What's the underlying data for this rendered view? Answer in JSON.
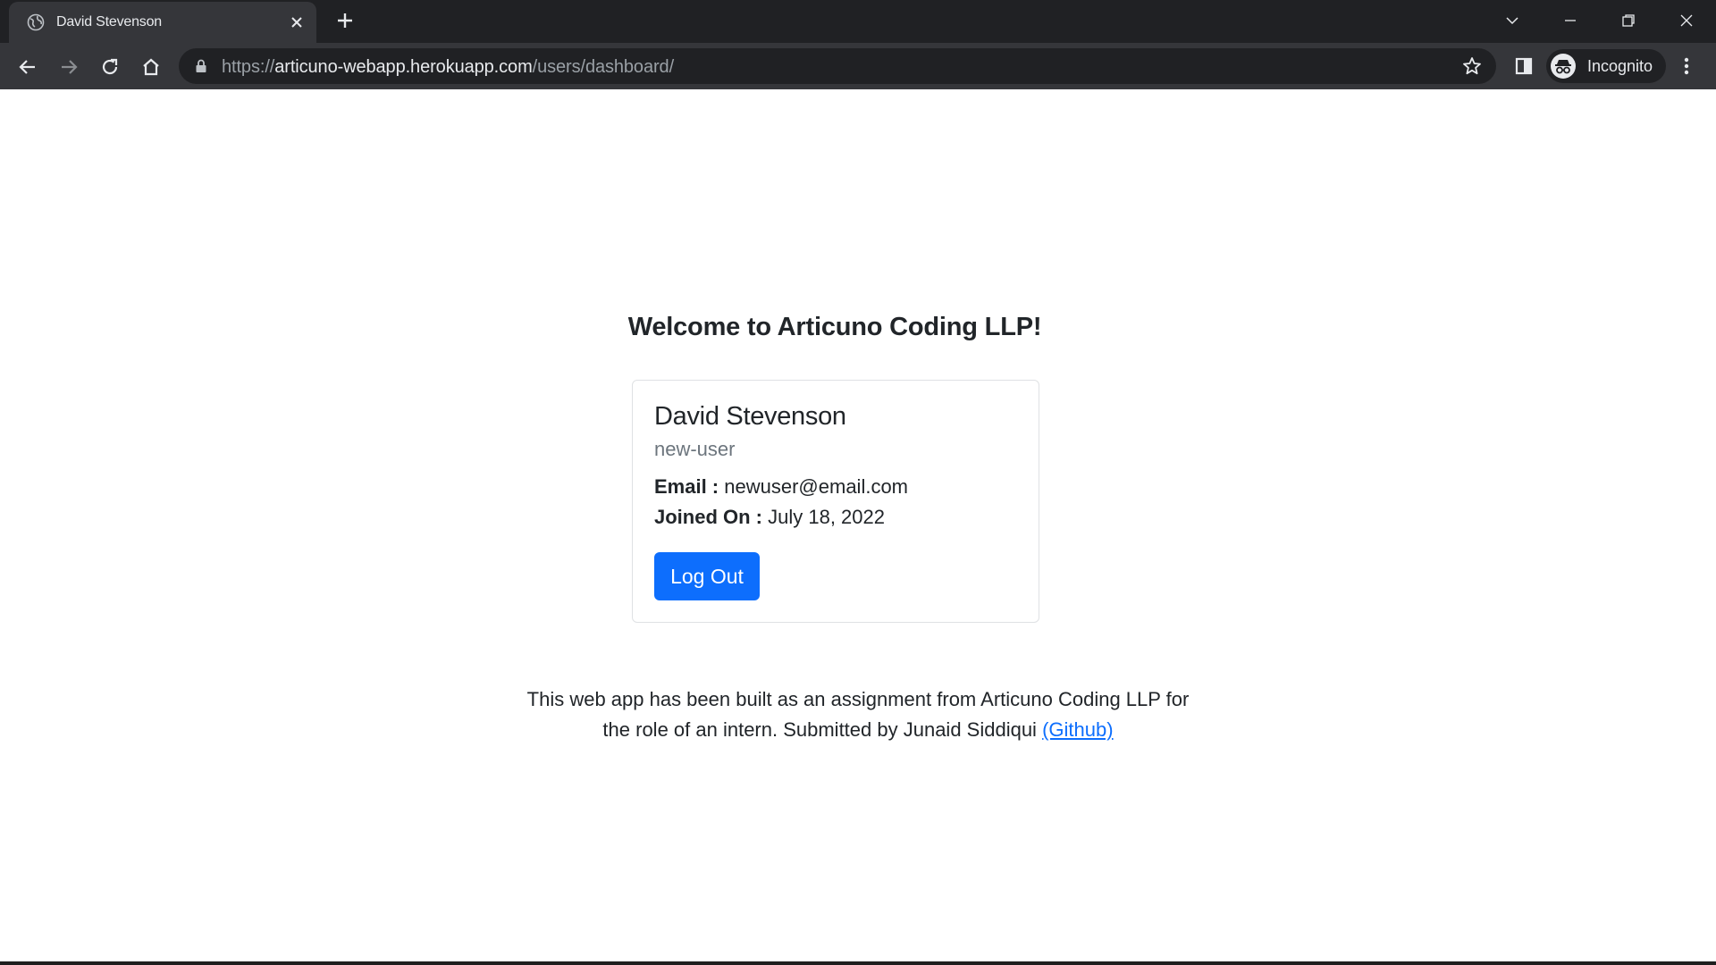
{
  "browser": {
    "tab_title": "David Stevenson",
    "url": {
      "scheme": "https://",
      "host": "articuno-webapp.herokuapp.com",
      "path": "/users/dashboard/"
    },
    "profile_label": "Incognito",
    "icons": [
      "globe-icon",
      "close-icon",
      "plus-icon",
      "chevron-down-icon",
      "minimize-icon",
      "restore-icon",
      "window-close-icon",
      "back-arrow-icon",
      "forward-arrow-icon",
      "reload-icon",
      "home-icon",
      "lock-icon",
      "star-icon",
      "side-panel-icon",
      "incognito-icon",
      "more-vert-icon"
    ]
  },
  "page": {
    "heading": "Welcome to Articuno Coding LLP!",
    "card": {
      "name": "David Stevenson",
      "username": "new-user",
      "email_label": "Email :",
      "email_value": "newuser@email.com",
      "joined_label": "Joined On :",
      "joined_value": "July 18, 2022",
      "logout_label": "Log Out"
    },
    "footer": {
      "line1": "This web app has been built as an assignment from Articuno Coding LLP for",
      "line2": "the role of an intern. Submitted by Junaid Siddiqui",
      "link_text": "(Github)"
    },
    "colors": {
      "primary": "#0d6efd",
      "text": "#212529",
      "muted": "#6c757d",
      "chrome_dark": "#202124",
      "chrome_toolbar": "#35363a"
    }
  }
}
